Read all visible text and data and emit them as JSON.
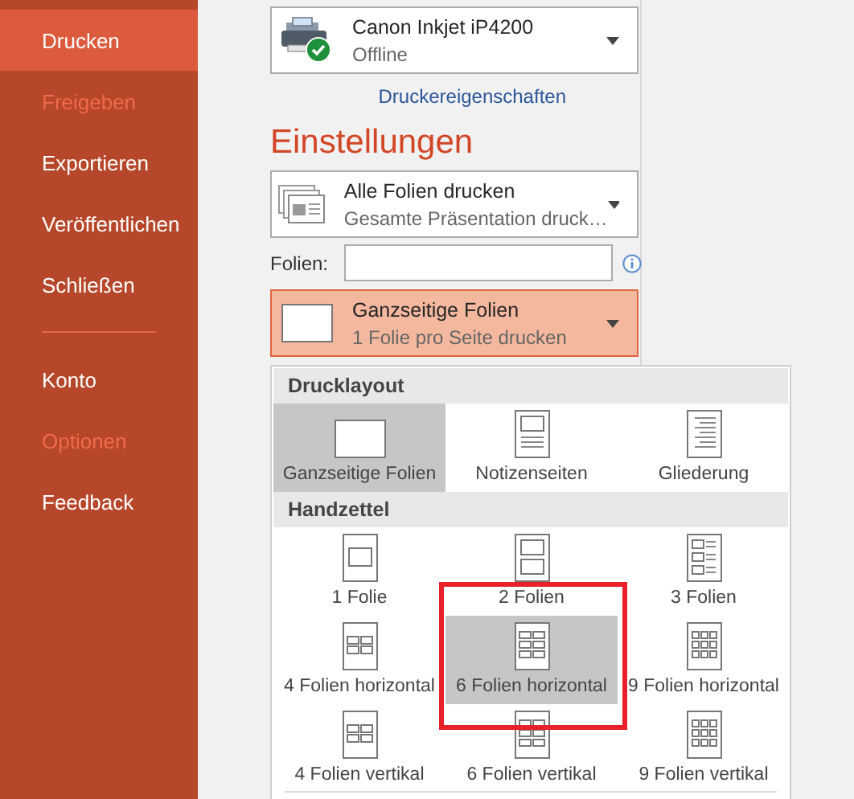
{
  "sidebar": {
    "items": [
      {
        "label": "Drucken",
        "selected": true,
        "disabled": false
      },
      {
        "label": "Freigeben",
        "selected": false,
        "disabled": true
      },
      {
        "label": "Exportieren",
        "selected": false,
        "disabled": false
      },
      {
        "label": "Veröffentlichen",
        "selected": false,
        "disabled": false
      },
      {
        "label": "Schließen",
        "selected": false,
        "disabled": false
      }
    ],
    "lower_items": [
      {
        "label": "Konto",
        "selected": false,
        "disabled": false
      },
      {
        "label": "Optionen",
        "selected": false,
        "disabled": true
      },
      {
        "label": "Feedback",
        "selected": false,
        "disabled": false
      }
    ]
  },
  "printer": {
    "name": "Canon Inkjet iP4200",
    "status": "Offline",
    "properties_link": "Druckereigenschaften"
  },
  "settings": {
    "heading": "Einstellungen",
    "slides_select": {
      "title": "Alle Folien drucken",
      "subtitle": "Gesamte Präsentation druck…"
    },
    "slides_field": {
      "label": "Folien:"
    },
    "layout_select": {
      "title": "Ganzseitige Folien",
      "subtitle": "1 Folie pro Seite drucken",
      "open": true
    }
  },
  "layout_menu": {
    "sections": [
      {
        "title": "Drucklayout",
        "items": [
          {
            "label": "Ganzseitige Folien",
            "kind": "slide",
            "selected": true
          },
          {
            "label": "Notizenseiten",
            "kind": "notes",
            "selected": false
          },
          {
            "label": "Gliederung",
            "kind": "outline",
            "selected": false
          }
        ]
      },
      {
        "title": "Handzettel",
        "items": [
          {
            "label": "1 Folie",
            "kind": "h1",
            "selected": false
          },
          {
            "label": "2 Folien",
            "kind": "h2",
            "selected": false
          },
          {
            "label": "3 Folien",
            "kind": "h3",
            "selected": false
          },
          {
            "label": "4 Folien horizontal",
            "kind": "h4",
            "selected": false
          },
          {
            "label": "6 Folien horizontal",
            "kind": "h6",
            "selected": true
          },
          {
            "label": "9 Folien horizontal",
            "kind": "h9",
            "selected": false
          },
          {
            "label": "4 Folien vertikal",
            "kind": "h4",
            "selected": false
          },
          {
            "label": "6 Folien vertikal",
            "kind": "h6",
            "selected": false
          },
          {
            "label": "9 Folien vertikal",
            "kind": "h9",
            "selected": false
          }
        ]
      }
    ]
  }
}
